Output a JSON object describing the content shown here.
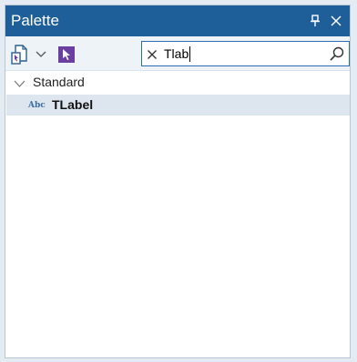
{
  "window": {
    "title": "Palette",
    "pin_icon": "pin-icon",
    "close_icon": "close-icon",
    "titlebar_color": "#1f5f99"
  },
  "toolbar": {
    "new_component_icon": "new-component-icon",
    "dropdown_icon": "chevron-down-icon",
    "select_icon": "pointer-select-icon"
  },
  "search": {
    "value": "Tlab",
    "clear_icon": "clear-icon",
    "search_icon": "search-icon"
  },
  "palette": {
    "categories": [
      {
        "label": "Standard",
        "expanded": true,
        "items": [
          {
            "icon": "abc-icon",
            "icon_text": "Abc",
            "label_match": "TLab",
            "label_rest": "el",
            "selected": true
          }
        ]
      }
    ]
  }
}
